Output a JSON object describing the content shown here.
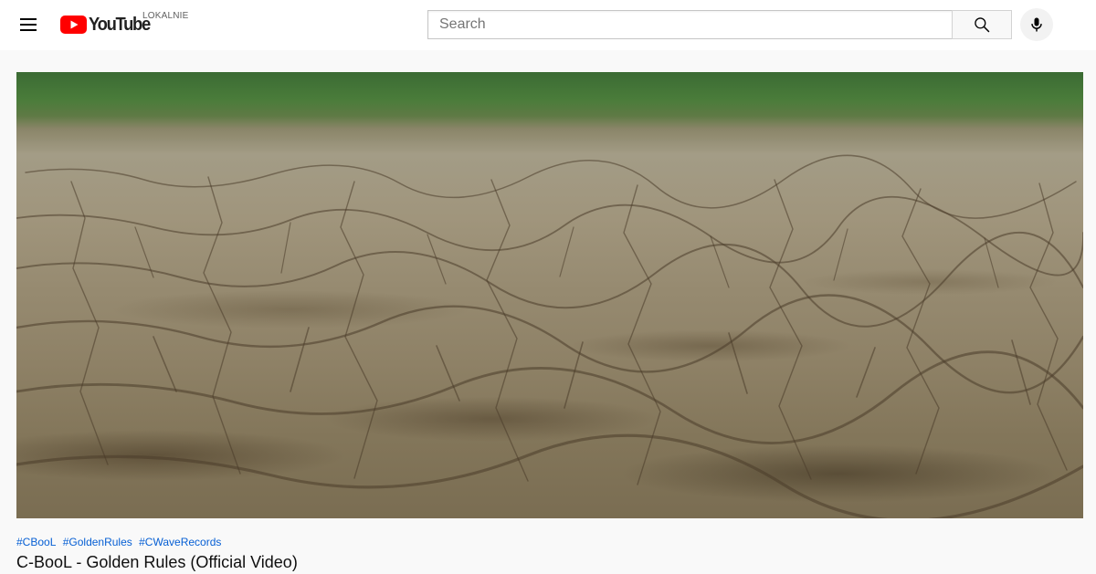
{
  "header": {
    "logo_text": "YouTube",
    "region_code": "LOKALNIE",
    "search_placeholder": "Search",
    "brand_color": "#ff0000",
    "icons": {
      "menu": "hamburger-menu-icon",
      "search": "search-icon",
      "voice": "microphone-icon"
    }
  },
  "video": {
    "hashtags": [
      "#CBooL",
      "#GoldenRules",
      "#CWaveRecords"
    ],
    "title": "C-BooL - Golden Rules (Official Video)",
    "hashtag_color": "#065fd4"
  }
}
